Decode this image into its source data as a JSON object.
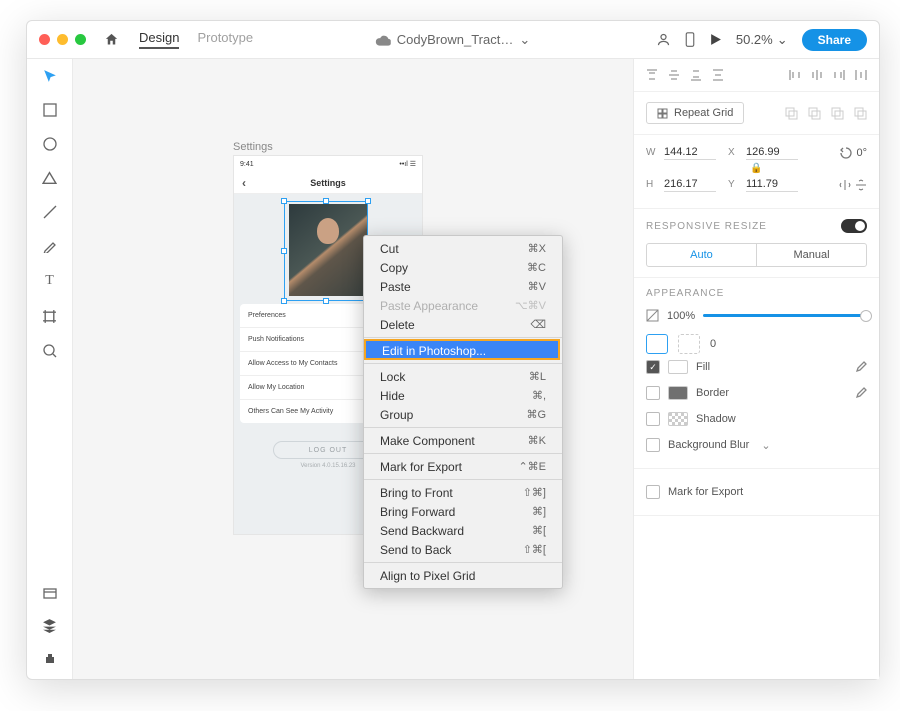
{
  "header": {
    "tabs": {
      "design": "Design",
      "prototype": "Prototype"
    },
    "doc": "CodyBrown_Tract… ",
    "zoom": "50.2%",
    "share": "Share"
  },
  "frame_label": "Settings",
  "artboard": {
    "time": "9:41",
    "title": "Settings",
    "rows": [
      "Preferences",
      "Push Notifications",
      "Allow Access to My Contacts",
      "Allow My Location",
      "Others Can See My Activity"
    ],
    "logout": "LOG OUT",
    "version": "Version 4.0.15.16.23"
  },
  "ctx": [
    {
      "l": "Cut",
      "s": "⌘X"
    },
    {
      "l": "Copy",
      "s": "⌘C"
    },
    {
      "l": "Paste",
      "s": "⌘V"
    },
    {
      "l": "Paste Appearance",
      "s": "⌥⌘V",
      "dis": true
    },
    {
      "l": "Delete",
      "s": "⌫"
    },
    {
      "sep": true
    },
    {
      "l": "Edit in Photoshop...",
      "sel": true
    },
    {
      "sep": true
    },
    {
      "l": "Lock",
      "s": "⌘L"
    },
    {
      "l": "Hide",
      "s": "⌘,"
    },
    {
      "l": "Group",
      "s": "⌘G"
    },
    {
      "sep": true
    },
    {
      "l": "Make Component",
      "s": "⌘K"
    },
    {
      "sep": true
    },
    {
      "l": "Mark for Export",
      "s": "⌃⌘E"
    },
    {
      "sep": true
    },
    {
      "l": "Bring to Front",
      "s": "⇧⌘]"
    },
    {
      "l": "Bring Forward",
      "s": "⌘]"
    },
    {
      "l": "Send Backward",
      "s": "⌘["
    },
    {
      "l": "Send to Back",
      "s": "⇧⌘["
    },
    {
      "sep": true
    },
    {
      "l": "Align to Pixel Grid"
    }
  ],
  "panel": {
    "repeat": "Repeat Grid",
    "w": "144.12",
    "x": "126.99",
    "h": "216.17",
    "y": "111.79",
    "rot": "0°",
    "resp_label": "RESPONSIVE RESIZE",
    "auto": "Auto",
    "manual": "Manual",
    "app_label": "APPEARANCE",
    "opacity": "100%",
    "corner": "0",
    "fill": "Fill",
    "border": "Border",
    "shadow": "Shadow",
    "bgblur": "Background Blur",
    "export": "Mark for Export"
  }
}
